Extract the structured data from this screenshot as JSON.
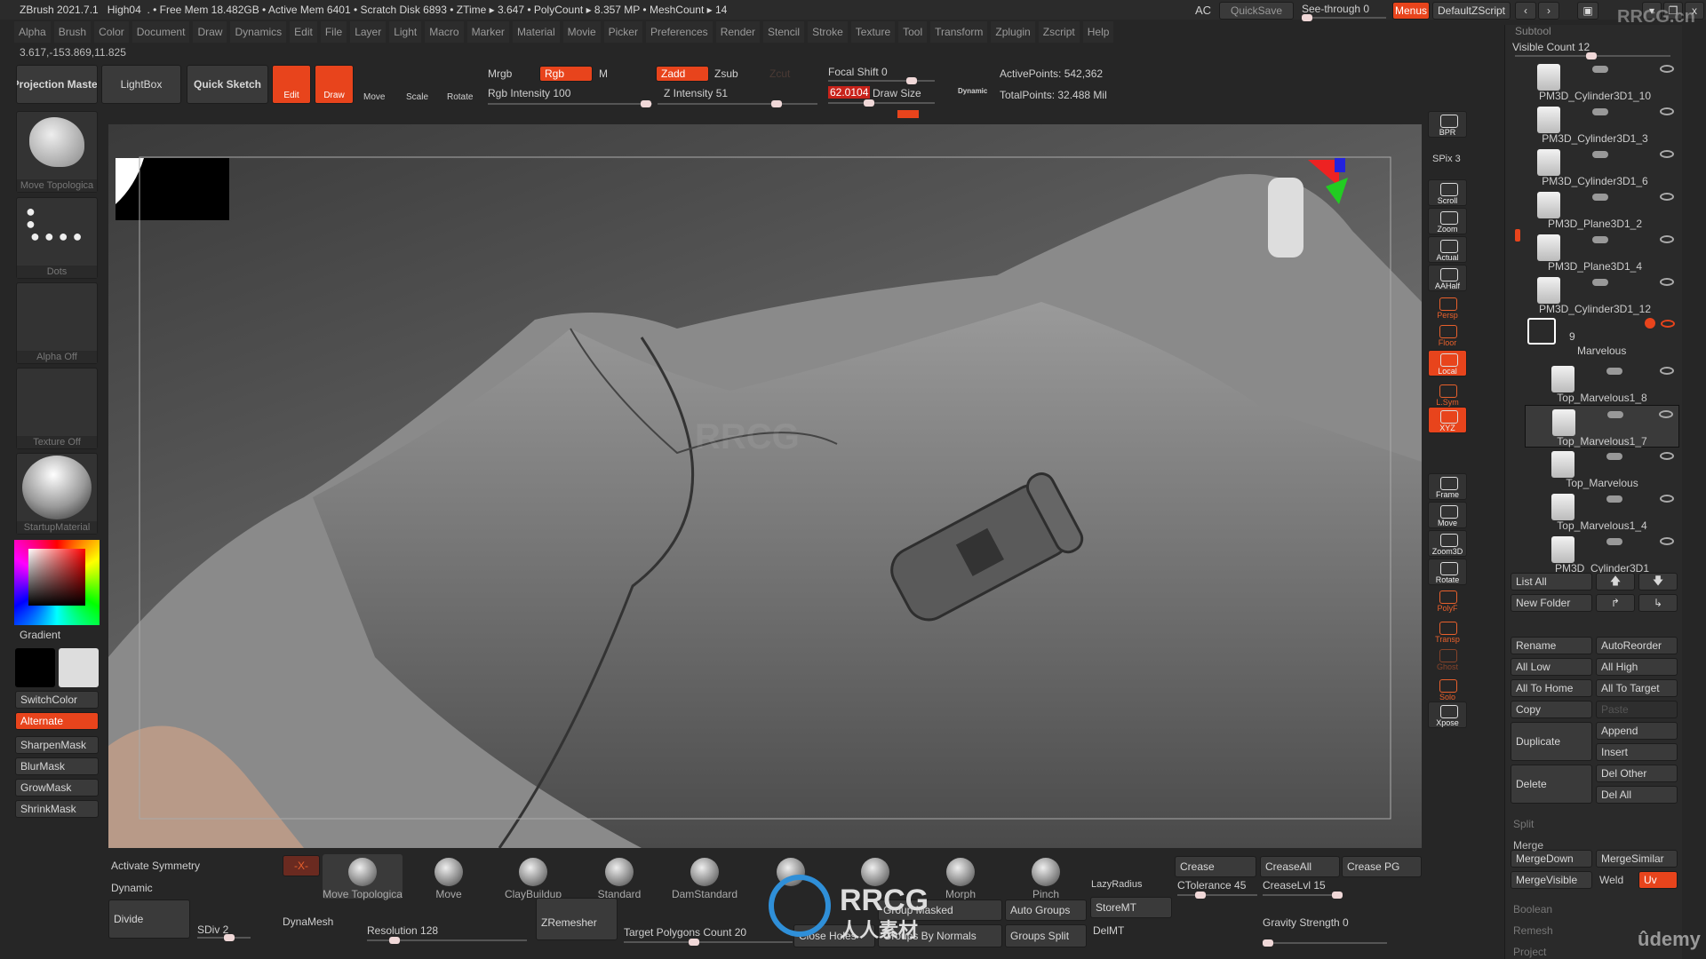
{
  "title_bar": {
    "app": "ZBrush 2021.7.1",
    "project": "High04",
    "stats": ". • Free Mem 18.482GB • Active Mem 6401 • Scratch Disk 6893 • ZTime ▸ 3.647 • PolyCount ▸ 8.357 MP • MeshCount ▸ 14",
    "ac": "AC",
    "quicksave": "QuickSave",
    "see_through": "See-through 0",
    "menus": "Menus",
    "default_zscript": "DefaultZScript",
    "watermark": "RRCG.cn"
  },
  "menu": [
    "Alpha",
    "Brush",
    "Color",
    "Document",
    "Draw",
    "Dynamics",
    "Edit",
    "File",
    "Layer",
    "Light",
    "Macro",
    "Marker",
    "Material",
    "Movie",
    "Picker",
    "Preferences",
    "Render",
    "Stencil",
    "Stroke",
    "Texture",
    "Tool",
    "Transform",
    "Zplugin",
    "Zscript",
    "Help"
  ],
  "coords": "3.617,-153.869,11.825",
  "top_shelf": {
    "projection_master": "Projection Master",
    "lightbox": "LightBox",
    "quick_sketch": "Quick Sketch",
    "edit": "Edit",
    "draw": "Draw",
    "move": "Move",
    "scale": "Scale",
    "rotate": "Rotate",
    "mrgb": "Mrgb",
    "rgb": "Rgb",
    "m": "M",
    "rgb_intensity": "Rgb Intensity 100",
    "zadd": "Zadd",
    "zsub": "Zsub",
    "zcut": "Zcut",
    "z_intensity": "Z Intensity 51",
    "focal_shift": "Focal Shift 0",
    "draw_size_value": "62.0104",
    "draw_size": "Draw Size",
    "dynamic": "Dynamic",
    "active_points": "ActivePoints: 542,362",
    "total_points": "TotalPoints: 32.488 Mil",
    "rgb_intensity_value": 100,
    "z_intensity_value": 51
  },
  "left_shelf": {
    "brush": "Move Topologica",
    "stroke": "Dots",
    "alpha": "Alpha Off",
    "texture": "Texture Off",
    "material": "StartupMaterial",
    "gradient": "Gradient",
    "buttons": [
      "SwitchColor",
      "Alternate",
      "SharpenMask",
      "BlurMask",
      "GrowMask",
      "ShrinkMask"
    ]
  },
  "right_toolbar": {
    "spix": "SPix 3",
    "buttons": [
      "BPR",
      "Scroll",
      "Zoom",
      "Actual",
      "AAHalf",
      "Persp",
      "Floor",
      "Local",
      "L.Sym",
      "XYZ",
      "Frame",
      "Move",
      "Zoom3D",
      "Rotate",
      "PolyF",
      "Transp",
      "Ghost",
      "Solo",
      "Xpose"
    ]
  },
  "subtool": {
    "header": "Subtool",
    "visible_count": "Visible Count 12",
    "items": [
      "PM3D_Cylinder3D1_10",
      "PM3D_Cylinder3D1_3",
      "PM3D_Cylinder3D1_6",
      "PM3D_Plane3D1_2",
      "PM3D_Plane3D1_4",
      "PM3D_Cylinder3D1_12"
    ],
    "folder": {
      "count": "9",
      "name": "Marvelous"
    },
    "folder_items": [
      "Top_Marvelous1_8",
      "Top_Marvelous1_7",
      "Top_Marvelous",
      "Top_Marvelous1_4",
      "PM3D_Cylinder3D1"
    ],
    "selected": "Top_Marvelous1_7",
    "buttons": {
      "list_all": "List All",
      "new_folder": "New Folder",
      "rename": "Rename",
      "autoreorder": "AutoReorder",
      "all_low": "All Low",
      "all_high": "All High",
      "all_to_home": "All To Home",
      "all_to_target": "All To Target",
      "copy": "Copy",
      "paste": "Paste",
      "duplicate": "Duplicate",
      "append": "Append",
      "insert": "Insert",
      "delete": "Delete",
      "del_other": "Del Other",
      "del_all": "Del All",
      "split": "Split",
      "merge": "Merge",
      "mergedown": "MergeDown",
      "mergesimilar": "MergeSimilar",
      "mergevisible": "MergeVisible",
      "weld": "Weld",
      "uv": "Uv",
      "boolean": "Boolean",
      "remesh": "Remesh",
      "project": "Project"
    }
  },
  "bottom": {
    "activate_symmetry": "Activate Symmetry",
    "x": "-X-",
    "dynamic": "Dynamic",
    "brushes": [
      "Move Topologica",
      "Move",
      "ClayBuildup",
      "Standard",
      "DamStandard",
      "",
      "",
      "Morph",
      "Pinch"
    ],
    "lazy_radius": "LazyRadius",
    "crease": "Crease",
    "crease_all": "CreaseAll",
    "crease_pg": "Crease PG",
    "ctolerance": "CTolerance 45",
    "crease_lvl": "CreaseLvl 15",
    "gravity": "Gravity Strength 0",
    "divide": "Divide",
    "sdiv": "SDiv 2",
    "dynamesh": "DynaMesh",
    "resolution": "Resolution 128",
    "zremesher": "ZRemesher",
    "target_polygons": "Target Polygons Count 20",
    "group_masked": "Group Masked",
    "close_holes": "Close Holes",
    "groups_by_normals": "Groups By Normals",
    "auto_groups": "Auto Groups",
    "groups_split": "Groups Split",
    "storemt": "StoreMT",
    "delmt": "DelMT"
  },
  "watermarks": {
    "rrcg": "RRCG",
    "rrcg_cn": "人人素材",
    "udemy": "ûdemy"
  },
  "colors": {
    "accent": "#e8441c",
    "panel": "#262626",
    "button": "#3a3a3a"
  }
}
